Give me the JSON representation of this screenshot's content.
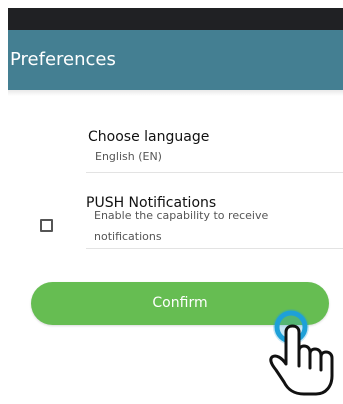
{
  "app_bar": {
    "title": "Preferences"
  },
  "settings": {
    "language": {
      "title": "Choose language",
      "value": "English (EN)"
    },
    "push": {
      "title": "PUSH Notifications",
      "description_line1": "Enable the capability to receive",
      "description_line2": "notifications",
      "checked": false
    }
  },
  "confirm_button": {
    "label": "Confirm"
  },
  "colors": {
    "status_bar": "#202124",
    "app_bar": "#447f92",
    "confirm": "#66bd52",
    "touch_ring": "#1ea0d8"
  },
  "icons": {
    "touch_cursor": "hand-pointer-icon"
  }
}
